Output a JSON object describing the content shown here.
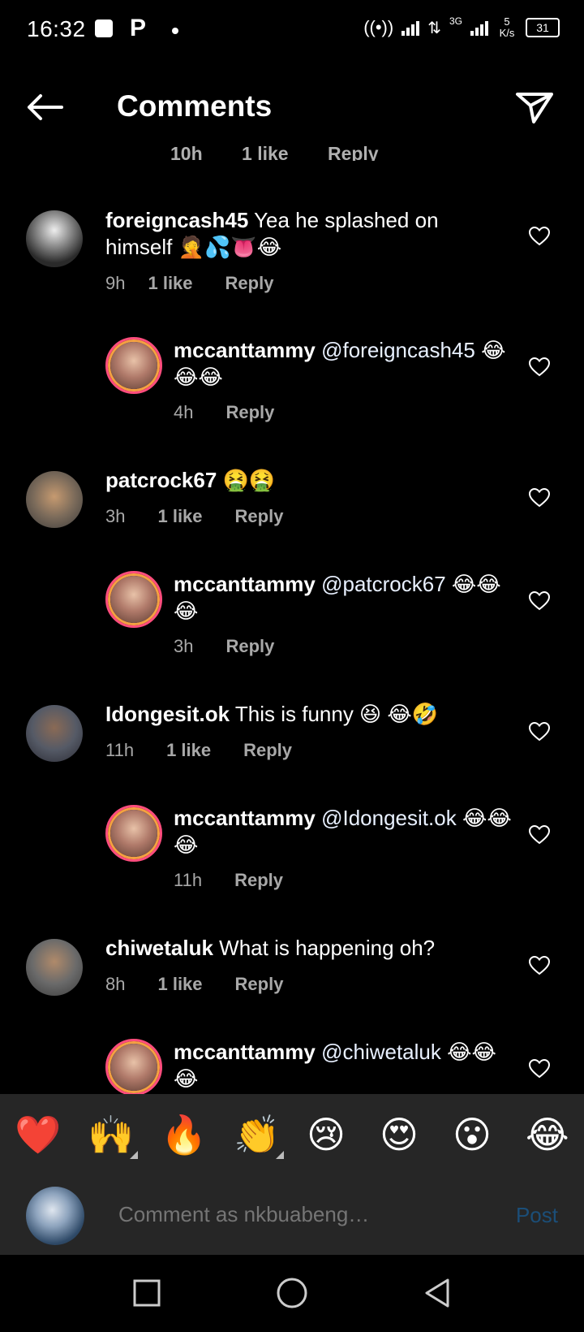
{
  "status_bar": {
    "time": "16:32",
    "p_icon": "P",
    "net_3g": "3G",
    "speed": "5 K/s",
    "battery": "31"
  },
  "header": {
    "title": "Comments"
  },
  "partial_row": {
    "time": "10h",
    "likes": "1 like",
    "reply": "Reply"
  },
  "comments": [
    {
      "user": "foreigncash45",
      "text": "Yea he splashed on himself 🤦💦👅😂",
      "time": "9h",
      "likes": "1 like",
      "reply": "Reply",
      "avatar_color": "#3a3a3a"
    },
    {
      "user": "mccanttammy",
      "mention": "@foreigncash45",
      "text": "😂😂😂",
      "time": "4h",
      "reply": "Reply",
      "avatar_color": "#b07a6a"
    },
    {
      "user": "patcrock67",
      "text": "🤮🤮",
      "time": "3h",
      "likes": "1 like",
      "reply": "Reply",
      "avatar_color": "#7a6a5a"
    },
    {
      "user": "mccanttammy",
      "mention": "@patcrock67",
      "text": "😂😂😂",
      "time": "3h",
      "reply": "Reply",
      "avatar_color": "#b07a6a"
    },
    {
      "user": "Idongesit.ok",
      "text": "This is funny 😆 😂🤣",
      "time": "11h",
      "likes": "1 like",
      "reply": "Reply",
      "avatar_color": "#555a66"
    },
    {
      "user": "mccanttammy",
      "mention": "@Idongesit.ok",
      "text": "😂😂😂",
      "time": "11h",
      "reply": "Reply",
      "avatar_color": "#b07a6a"
    },
    {
      "user": "chiwetaluk",
      "text": "What is happening oh?",
      "time": "8h",
      "likes": "1 like",
      "reply": "Reply",
      "avatar_color": "#6a6a6a"
    },
    {
      "user": "mccanttammy",
      "mention": "@chiwetaluk",
      "text": "😂😂😂",
      "avatar_color": "#b07a6a"
    }
  ],
  "emoji_bar": [
    "❤️",
    "🙌",
    "🔥",
    "👏",
    "😢",
    "😍",
    "😮",
    "😂"
  ],
  "input": {
    "placeholder": "Comment as nkbuabeng…",
    "post_label": "Post"
  },
  "icons": {
    "back": "back-arrow-icon",
    "send": "send-icon",
    "heart": "heart-outline-icon"
  }
}
